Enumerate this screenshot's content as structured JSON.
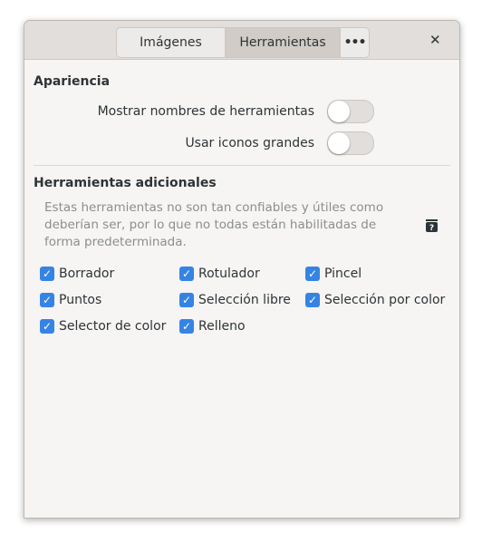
{
  "header": {
    "tabs": [
      {
        "label": "Imágenes",
        "active": false
      },
      {
        "label": "Herramientas",
        "active": true
      }
    ],
    "more_label": "•••",
    "close_label": "✕"
  },
  "appearance": {
    "title": "Apariencia",
    "show_names": {
      "label": "Mostrar nombres de herramientas",
      "on": false
    },
    "big_icons": {
      "label": "Usar iconos grandes",
      "on": false
    }
  },
  "additional": {
    "title": "Herramientas adicionales",
    "description": "Estas herramientas no son tan confiables y útiles como deberían ser, por lo que no todas están habilitadas de forma predeterminada.",
    "tools": [
      {
        "label": "Borrador",
        "checked": true
      },
      {
        "label": "Rotulador",
        "checked": true
      },
      {
        "label": "Pincel",
        "checked": true
      },
      {
        "label": "Puntos",
        "checked": true
      },
      {
        "label": "Selección libre",
        "checked": true
      },
      {
        "label": "Selección por color",
        "checked": true
      },
      {
        "label": "Selector de color",
        "checked": true
      },
      {
        "label": "Relleno",
        "checked": true
      }
    ]
  },
  "colors": {
    "accent": "#3584e4"
  }
}
